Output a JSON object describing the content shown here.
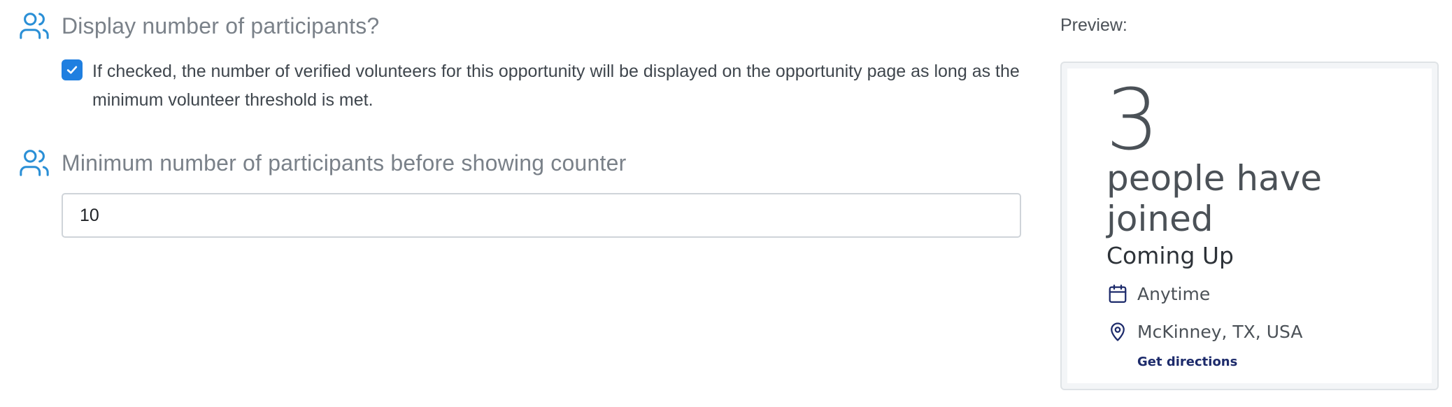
{
  "settings": [
    {
      "icon": "people-icon",
      "title": "Display number of participants?",
      "checkbox": {
        "checked": true,
        "label": "If checked, the number of verified volunteers for this opportunity will be displayed on the opportunity page as long as the minimum volunteer threshold is met."
      }
    },
    {
      "icon": "people-icon",
      "title": "Minimum number of participants before showing counter",
      "input": {
        "value": "10"
      }
    }
  ],
  "preview": {
    "label": "Preview:",
    "count": "3",
    "count_caption": "people have joined",
    "section_title": "Coming Up",
    "date": {
      "icon": "calendar-icon",
      "text": "Anytime"
    },
    "location": {
      "icon": "location-pin-icon",
      "text": "McKinney, TX, USA"
    },
    "directions_link": "Get directions"
  },
  "colors": {
    "accent_blue": "#1f7fe0",
    "icon_blue": "#2a8fd6",
    "navy": "#1d2b6b"
  }
}
